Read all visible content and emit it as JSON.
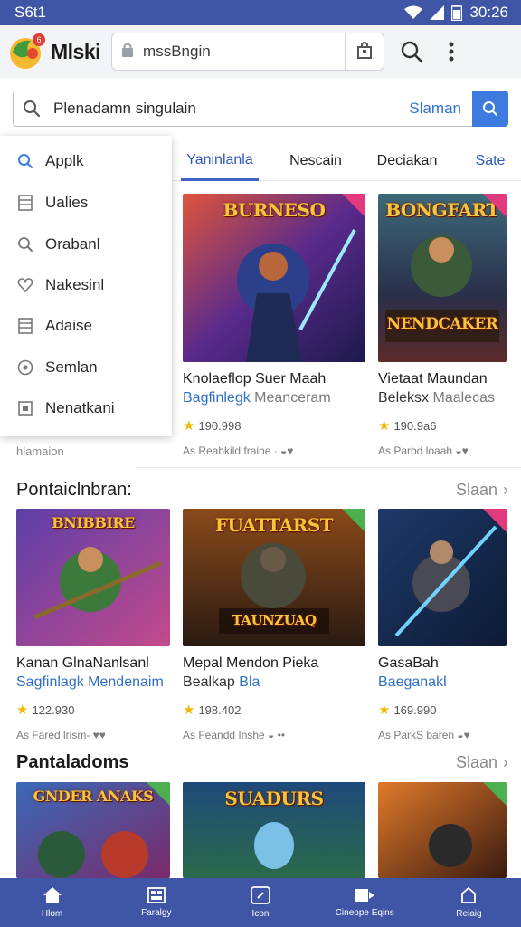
{
  "status_bar": {
    "time_left": "S6t1",
    "time_right": "30:26"
  },
  "app_bar": {
    "app_name": "Mlski",
    "notification_count": "6",
    "url": "mssBngin"
  },
  "search": {
    "query": "Plenadamn singulain",
    "link_label": "Slaman"
  },
  "tabs": [
    {
      "label": "Yaninlanla"
    },
    {
      "label": "Nescain"
    },
    {
      "label": "Deciakan"
    },
    {
      "label": "Sate"
    }
  ],
  "dropdown": {
    "items": [
      {
        "label": "Applk",
        "icon": "search-icon"
      },
      {
        "label": "Ualies",
        "icon": "list-icon"
      },
      {
        "label": "Orabanl",
        "icon": "search-icon"
      },
      {
        "label": "Nakesinl",
        "icon": "heart-icon"
      },
      {
        "label": "Adaise",
        "icon": "list-icon"
      },
      {
        "label": "Semlan",
        "icon": "settings-icon"
      },
      {
        "label": "Nenatkani",
        "icon": "square-icon"
      }
    ]
  },
  "sub_note": "hlamaion",
  "row1": [
    {
      "thumb_title": "BURNESO",
      "name": "Knolaeflop Suer Maah",
      "dev": "Bagfinlegk",
      "dev_extra": "Meanceram",
      "rating": "190.998",
      "meta": "As Reahkild fraine · ◒♥",
      "badge": "pink"
    },
    {
      "thumb_title": "BONGFART",
      "thumb_sub": "NENDCAKER",
      "name": "Vietaat Maundan",
      "dev": "Beleksx",
      "dev_extra": "Maalecas",
      "rating": "190.9a6",
      "meta": "As Parbd loaah ◒♥",
      "badge": "pink"
    }
  ],
  "section1": {
    "title": "Pontaiclnbran:",
    "more": "Slaan"
  },
  "row2": [
    {
      "thumb_title": "BNIBBIRE",
      "name": "Kanan GlnaNanlsanl",
      "dev": "Sagfinlagk Mendenaim",
      "rating": "122.930",
      "meta": "As Fared lrism- ♥♥",
      "badge": "none"
    },
    {
      "thumb_title": "FUATTARST",
      "thumb_sub": "TAUNZUAQ",
      "name": "Mepal Mendon Pieka",
      "dev": "Bealkap",
      "dev_extra": "Bla",
      "rating": "198.402",
      "meta": "As Feandd Inshe ◒ ••",
      "badge": "green"
    },
    {
      "thumb_title": "",
      "name": "GasaBah",
      "dev": "Baeganakl",
      "rating": "169.990",
      "meta": "As ParkS baren ◒♥",
      "badge": "pink"
    }
  ],
  "section2": {
    "title": "Pantaladoms",
    "more": "Slaan"
  },
  "row3": [
    {
      "thumb_title": "GNDER ANAKS",
      "badge": "green"
    },
    {
      "thumb_title": "SUADURS",
      "badge": "none"
    },
    {
      "thumb_title": "",
      "badge": "green"
    }
  ],
  "bottom_nav": [
    {
      "label": "Hlom",
      "icon": "home-icon"
    },
    {
      "label": "Faralgy",
      "icon": "grid-icon"
    },
    {
      "label": "Icon",
      "icon": "compass-icon"
    },
    {
      "label": "Cineope Eqins",
      "icon": "tag-icon"
    },
    {
      "label": "Reiaig",
      "icon": "shop-icon"
    }
  ],
  "colors": {
    "primary": "#3f55a5",
    "accent": "#3d7be0",
    "link": "#2e6fc4",
    "star": "#f2b705"
  }
}
